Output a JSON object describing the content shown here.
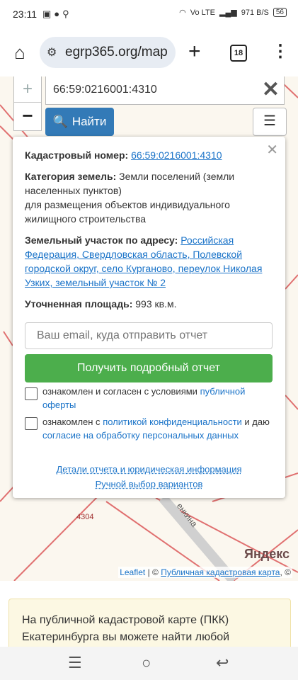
{
  "status": {
    "time": "23:11",
    "left_icons": [
      "gallery-icon",
      "chat-icon",
      "search-icon"
    ],
    "net": "Vo LTE",
    "speed": "971 B/S",
    "battery": "56"
  },
  "browser": {
    "url": "egrp365.org/map",
    "tab_count": "18"
  },
  "map": {
    "search_value": "66:59:0216001:4310",
    "find_label": "Найти",
    "parcel_label": "4304",
    "street_label": "енкина",
    "yandex_logo": "Яндекс",
    "attribution": {
      "leaflet": "Leaflet",
      "sep": " | © ",
      "pkk": "Публичная кадастровая карта",
      "tail": ", ©"
    }
  },
  "popup": {
    "cadastral_label": "Кадастровый номер:",
    "cadastral_value": "66:59:0216001:4310",
    "category_label": "Категория земель:",
    "category_value": "Земли поселений (земли населенных пунктов)",
    "purpose": "для размещения объектов индивидуального жилищного строительства",
    "address_label": "Земельный участок по адресу:",
    "address_value": "Российская Федерация, Свердловская область, Полевской городской округ, село Курганово, переулок Николая Узких, земельный участок № 2",
    "area_label": "Уточненная площадь:",
    "area_value": "993 кв.м.",
    "email_placeholder": "Ваш email, куда отправить отчет",
    "get_report_button": "Получить подробный отчет",
    "consent1_text": "ознакомлен и согласен с условиями ",
    "consent1_link": "публичной оферты",
    "consent2_text_a": "ознакомлен с ",
    "consent2_link_a": "политикой конфиденциальности",
    "consent2_text_b": " и даю ",
    "consent2_link_b": "согласие на обработку персональных данных",
    "details_link": "Детали отчета и юридическая информация",
    "manual_link": "Ручной выбор вариантов"
  },
  "info": {
    "text": "На публичной кадастровой карте (ПКК) Екатеринбурга вы можете найти любой"
  },
  "colors": {
    "find_button": "#337ab7",
    "get_report_button": "#4cae4c",
    "link": "#1a73c8",
    "parcel_lines": "#e07070",
    "info_bg": "#fcf8e3"
  }
}
